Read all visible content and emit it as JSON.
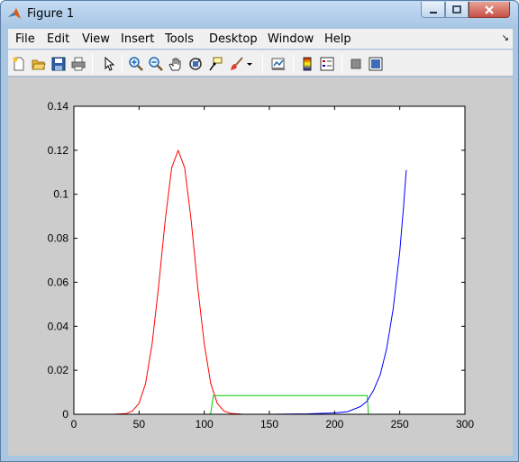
{
  "window": {
    "title": "Figure 1",
    "controls": {
      "minimize": "minimize",
      "maximize": "maximize",
      "close": "close"
    }
  },
  "menubar": {
    "items": [
      "File",
      "Edit",
      "View",
      "Insert",
      "Tools",
      "Desktop",
      "Window",
      "Help"
    ]
  },
  "toolbar": {
    "buttons": [
      {
        "name": "new-figure-icon"
      },
      {
        "name": "open-file-icon"
      },
      {
        "name": "save-icon"
      },
      {
        "name": "print-icon"
      },
      {
        "name": "edit-plot-arrow-icon"
      },
      {
        "name": "zoom-in-icon"
      },
      {
        "name": "zoom-out-icon"
      },
      {
        "name": "pan-hand-icon"
      },
      {
        "name": "rotate-3d-icon"
      },
      {
        "name": "data-cursor-icon"
      },
      {
        "name": "brush-icon"
      },
      {
        "name": "link-plot-icon"
      },
      {
        "name": "insert-colorbar-icon"
      },
      {
        "name": "insert-legend-icon"
      },
      {
        "name": "hide-plot-tools-icon"
      },
      {
        "name": "show-plot-tools-icon"
      }
    ]
  },
  "colors": {
    "figure_bg": "#cccccc",
    "axes_bg": "#ffffff",
    "series_red": "#ff0000",
    "series_green": "#00cc00",
    "series_blue": "#0000ff"
  },
  "chart_data": {
    "type": "line",
    "title": "",
    "xlabel": "",
    "ylabel": "",
    "xlim": [
      0,
      300
    ],
    "ylim": [
      0,
      0.14
    ],
    "xticks": [
      "0",
      "50",
      "100",
      "150",
      "200",
      "250",
      "300"
    ],
    "yticks": [
      "0",
      "0.02",
      "0.04",
      "0.06",
      "0.08",
      "0.1",
      "0.12",
      "0.14"
    ],
    "grid": false,
    "legend": "none",
    "series": [
      {
        "color": "#ff0000",
        "description": "gaussian peak centred at x=80",
        "x": [
          0,
          30,
          40,
          45,
          50,
          55,
          60,
          65,
          70,
          75,
          80,
          85,
          90,
          95,
          100,
          105,
          110,
          115,
          120,
          130,
          150,
          255
        ],
        "y": [
          0,
          0,
          0.0003,
          0.0015,
          0.005,
          0.014,
          0.032,
          0.058,
          0.088,
          0.112,
          0.12,
          0.112,
          0.088,
          0.058,
          0.032,
          0.014,
          0.005,
          0.0015,
          0.0004,
          0,
          0,
          0
        ]
      },
      {
        "color": "#00cc00",
        "description": "uniform box between x=105 and x=225",
        "x": [
          0,
          104,
          105,
          107,
          225,
          226,
          255
        ],
        "y": [
          0,
          0,
          0.0005,
          0.0085,
          0.0085,
          0,
          0
        ]
      },
      {
        "color": "#0000ff",
        "description": "exponential rise toward x=255",
        "x": [
          0,
          150,
          180,
          200,
          210,
          220,
          225,
          230,
          235,
          240,
          245,
          250,
          253,
          255
        ],
        "y": [
          0,
          0,
          0.0002,
          0.0006,
          0.0012,
          0.0035,
          0.006,
          0.011,
          0.018,
          0.03,
          0.048,
          0.074,
          0.095,
          0.111
        ]
      }
    ]
  }
}
